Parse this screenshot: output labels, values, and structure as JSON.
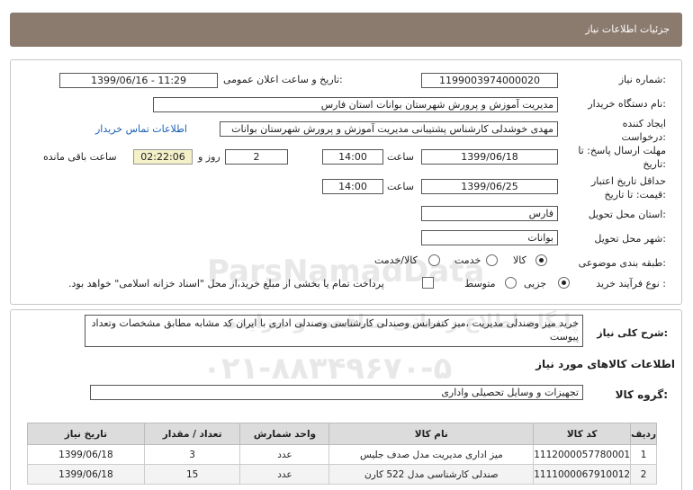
{
  "header": {
    "title": "جزئیات اطلاعات نیاز"
  },
  "form": {
    "need_number_label": "شماره نیاز:",
    "need_number": "1199003974000020",
    "announce_label": "تاریخ و ساعت اعلان عمومی:",
    "announce_value": "1399/06/16 - 11:29",
    "buyer_label": "نام دستگاه خریدار:",
    "buyer_value": "مدیریت آموزش و پرورش شهرستان بوانات استان فارس",
    "creator_label": "ایجاد کننده درخواست:",
    "creator_value": "مهدی خوشدلی کارشناس پشتیبانی مدیریت آموزش و پرورش شهرستان بوانات",
    "contact_link": "اطلاعات تماس خریدار",
    "send_deadline_label": "مهلت ارسال پاسخ: تا تاریخ:",
    "send_date": "1399/06/18",
    "time_label": "ساعت",
    "send_time": "14:00",
    "days": "2",
    "days_label": "روز و",
    "remaining": "02:22:06",
    "remaining_label": "ساعت باقی مانده",
    "validity_label": "حداقل تاریخ اعتبار قیمت: تا تاریخ:",
    "validity_date": "1399/06/25",
    "validity_time": "14:00",
    "province_label": "استان محل تحویل:",
    "province": "فارس",
    "city_label": "شهر محل تحویل:",
    "city": "بوانات",
    "category_label": "طبقه بندی موضوعی:",
    "category_options": [
      "کالا",
      "خدمت",
      "کالا/خدمت"
    ],
    "process_label": "نوع فرآیند خرید :",
    "process_options": [
      "جزیی",
      "متوسط"
    ],
    "payment_note": "پرداخت تمام یا بخشی از مبلغ خرید،از محل \"اسناد خزانه اسلامی\" خواهد بود."
  },
  "description": {
    "label": "شرح کلی نیاز:",
    "text": "خرید میز وصندلی مدیریت ،میز کنفرانس وصندلی کارشناسی وصندلی اداری با ایران کد مشابه مطابق مشخصات وتعداد پیوست"
  },
  "goods": {
    "section_title": "اطلاعات کالاهای مورد نیاز",
    "group_label": "گروه کالا:",
    "group_value": "تجهیزات و وسایل تحصیلی واداری",
    "columns": [
      "ردیف",
      "کد کالا",
      "نام کالا",
      "واحد شمارش",
      "تعداد / مقدار",
      "تاریخ نیاز"
    ],
    "rows": [
      [
        "1",
        "1112000057780001",
        "میز اداری مدیریت مدل صدف جلیس",
        "عدد",
        "3",
        "1399/06/18"
      ],
      [
        "2",
        "1111000067910012",
        "صندلی کارشناسی مدل 522 کارن",
        "عدد",
        "15",
        "1399/06/18"
      ]
    ]
  },
  "watermark": {
    "text1": "ParsNamadData",
    "text2": "پایگاه اطلاع رسانی مناقصه و مزایده",
    "text3": "۰۲۱-۸۸۳۴۹۶۷۰-۵"
  }
}
